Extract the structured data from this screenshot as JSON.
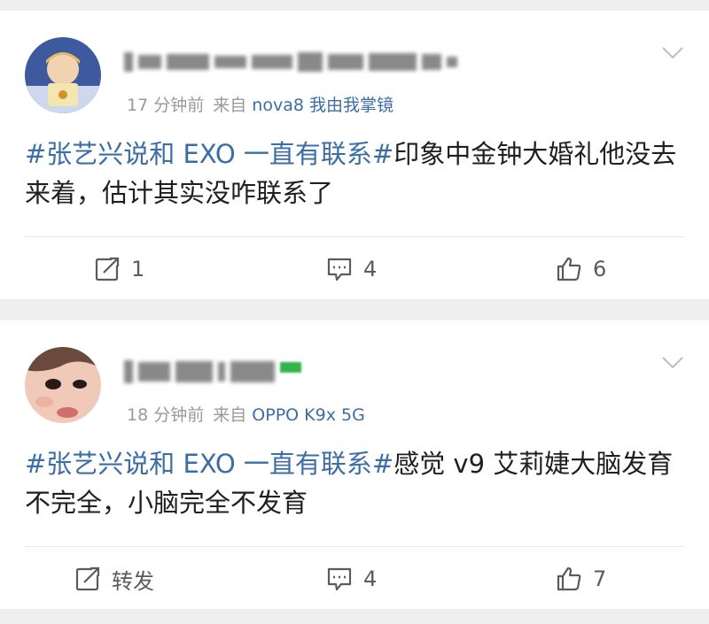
{
  "posts": [
    {
      "timestamp": "17 分钟前",
      "source_prefix": "来自",
      "source": "nova8 我由我掌镜",
      "hashtag": "#张艺兴说和 EXO 一直有联系#",
      "text": "印象中金钟大婚礼他没去来着，估计其实没咋联系了",
      "actions": {
        "repost": "1",
        "comment": "4",
        "like": "6"
      }
    },
    {
      "timestamp": "18 分钟前",
      "source_prefix": "来自",
      "source": "OPPO K9x 5G",
      "hashtag": "#张艺兴说和 EXO 一直有联系#",
      "text": "感觉 v9 艾莉婕大脑发育不完全，小脑完全不发育",
      "actions": {
        "repost": "转发",
        "comment": "4",
        "like": "7"
      }
    }
  ],
  "colors": {
    "link": "#3c6ea6",
    "meta": "#9a9a9a",
    "background": "#efefef"
  },
  "icons": [
    "chevron-down-icon",
    "repost-icon",
    "comment-icon",
    "like-icon"
  ]
}
